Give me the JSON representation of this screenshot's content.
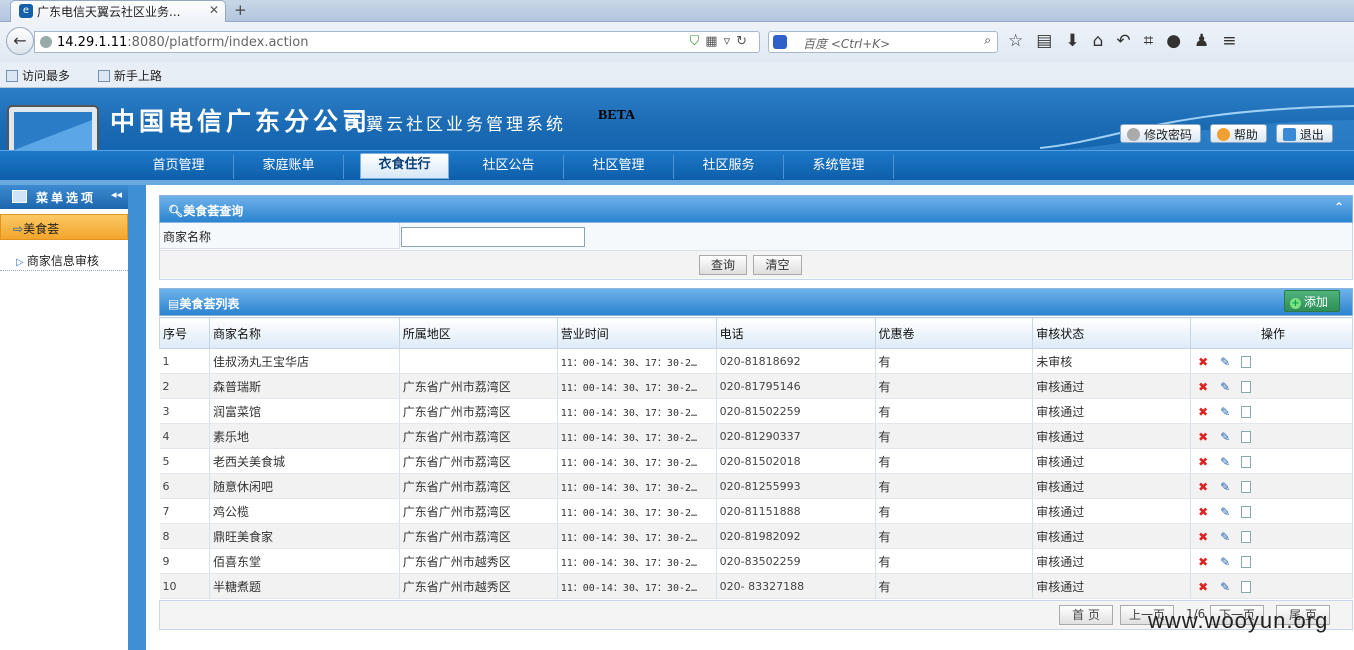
{
  "browser": {
    "tab_title": "广东电信天翼云社区业务...",
    "tab_favicon": "China Telecom",
    "url_host": "14.29.1.11",
    "url_rest": ":8080/platform/index.action",
    "search_placeholder": "百度 <Ctrl+K>",
    "bookmarks": [
      "访问最多",
      "新手上路"
    ]
  },
  "header": {
    "title": "中国电信广东分公司",
    "subtitle": "天翼云社区业务管理系统",
    "beta": "BETA",
    "buttons": {
      "change_password": "修改密码",
      "help": "帮助",
      "logout": "退出"
    }
  },
  "nav": [
    {
      "label": "首页管理",
      "active": false
    },
    {
      "label": "家庭账单",
      "active": false
    },
    {
      "label": "衣食住行",
      "active": true
    },
    {
      "label": "社区公告",
      "active": false
    },
    {
      "label": "社区管理",
      "active": false
    },
    {
      "label": "社区服务",
      "active": false
    },
    {
      "label": "系统管理",
      "active": false
    }
  ],
  "sidebar": {
    "header": "菜单选项",
    "items": [
      {
        "label": "美食荟",
        "selected": true
      },
      {
        "label": "商家信息审核",
        "selected": false
      }
    ]
  },
  "query": {
    "title": "美食荟查询",
    "field_label": "商家名称",
    "field_value": "",
    "query_button": "查询",
    "clear_button": "清空"
  },
  "list": {
    "title": "美食荟列表",
    "add_button": "添加",
    "columns": [
      "序号",
      "商家名称",
      "所属地区",
      "营业时间",
      "电话",
      "优惠卷",
      "审核状态",
      "操作"
    ],
    "rows": [
      [
        "1",
        "佳叔汤丸王宝华店",
        "",
        "11：00-14：30、17：30-2…",
        "020-81818692",
        "有",
        "未审核"
      ],
      [
        "2",
        "森普瑞斯",
        "广东省广州市荔湾区",
        "11：00-14：30、17：30-2…",
        "020-81795146",
        "有",
        "审核通过"
      ],
      [
        "3",
        "润富菜馆",
        "广东省广州市荔湾区",
        "11：00-14：30、17：30-2…",
        "020-81502259",
        "有",
        "审核通过"
      ],
      [
        "4",
        "素乐地",
        "广东省广州市荔湾区",
        "11：00-14：30、17：30-2…",
        "020-81290337",
        "有",
        "审核通过"
      ],
      [
        "5",
        "老西关美食城",
        "广东省广州市荔湾区",
        "11：00-14：30、17：30-2…",
        "020-81502018",
        "有",
        "审核通过"
      ],
      [
        "6",
        "随意休闲吧",
        "广东省广州市荔湾区",
        "11：00-14：30、17：30-2…",
        "020-81255993",
        "有",
        "审核通过"
      ],
      [
        "7",
        "鸡公榄",
        "广东省广州市荔湾区",
        "11：00-14：30、17：30-2…",
        "020-81151888",
        "有",
        "审核通过"
      ],
      [
        "8",
        "鼎旺美食家",
        "广东省广州市荔湾区",
        "11：00-14：30、17：30-2…",
        "020-81982092",
        "有",
        "审核通过"
      ],
      [
        "9",
        "佰喜东堂",
        "广东省广州市越秀区",
        "11：00-14：30、17：30-2…",
        "020-83502259",
        "有",
        "审核通过"
      ],
      [
        "10",
        "半糖煮题",
        "广东省广州市越秀区",
        "11：00-14：30、17：30-2…",
        "020- 83327188",
        "有",
        "审核通过"
      ]
    ]
  },
  "pager": {
    "first": "首 页",
    "prev": "上一页",
    "page_info": "1/6",
    "next": "下一页",
    "last": "尾 页"
  },
  "watermark": "www.wooyun.org",
  "icons": {
    "delete": "delete-icon",
    "edit": "edit-icon",
    "detail": "document-icon"
  }
}
